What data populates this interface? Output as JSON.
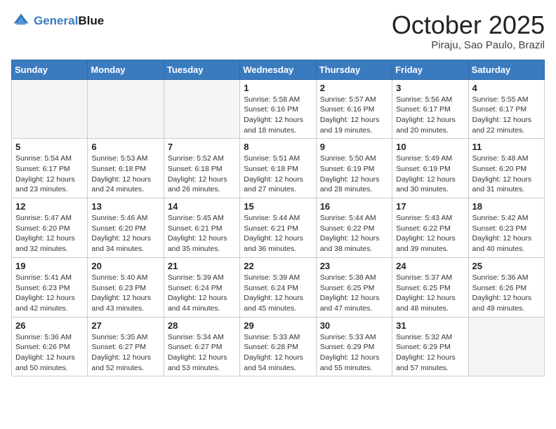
{
  "header": {
    "logo_line1": "General",
    "logo_line2": "Blue",
    "month": "October 2025",
    "location": "Piraju, Sao Paulo, Brazil"
  },
  "days_of_week": [
    "Sunday",
    "Monday",
    "Tuesday",
    "Wednesday",
    "Thursday",
    "Friday",
    "Saturday"
  ],
  "weeks": [
    [
      {
        "day": "",
        "info": ""
      },
      {
        "day": "",
        "info": ""
      },
      {
        "day": "",
        "info": ""
      },
      {
        "day": "1",
        "info": "Sunrise: 5:58 AM\nSunset: 6:16 PM\nDaylight: 12 hours\nand 18 minutes."
      },
      {
        "day": "2",
        "info": "Sunrise: 5:57 AM\nSunset: 6:16 PM\nDaylight: 12 hours\nand 19 minutes."
      },
      {
        "day": "3",
        "info": "Sunrise: 5:56 AM\nSunset: 6:17 PM\nDaylight: 12 hours\nand 20 minutes."
      },
      {
        "day": "4",
        "info": "Sunrise: 5:55 AM\nSunset: 6:17 PM\nDaylight: 12 hours\nand 22 minutes."
      }
    ],
    [
      {
        "day": "5",
        "info": "Sunrise: 5:54 AM\nSunset: 6:17 PM\nDaylight: 12 hours\nand 23 minutes."
      },
      {
        "day": "6",
        "info": "Sunrise: 5:53 AM\nSunset: 6:18 PM\nDaylight: 12 hours\nand 24 minutes."
      },
      {
        "day": "7",
        "info": "Sunrise: 5:52 AM\nSunset: 6:18 PM\nDaylight: 12 hours\nand 26 minutes."
      },
      {
        "day": "8",
        "info": "Sunrise: 5:51 AM\nSunset: 6:18 PM\nDaylight: 12 hours\nand 27 minutes."
      },
      {
        "day": "9",
        "info": "Sunrise: 5:50 AM\nSunset: 6:19 PM\nDaylight: 12 hours\nand 28 minutes."
      },
      {
        "day": "10",
        "info": "Sunrise: 5:49 AM\nSunset: 6:19 PM\nDaylight: 12 hours\nand 30 minutes."
      },
      {
        "day": "11",
        "info": "Sunrise: 5:48 AM\nSunset: 6:20 PM\nDaylight: 12 hours\nand 31 minutes."
      }
    ],
    [
      {
        "day": "12",
        "info": "Sunrise: 5:47 AM\nSunset: 6:20 PM\nDaylight: 12 hours\nand 32 minutes."
      },
      {
        "day": "13",
        "info": "Sunrise: 5:46 AM\nSunset: 6:20 PM\nDaylight: 12 hours\nand 34 minutes."
      },
      {
        "day": "14",
        "info": "Sunrise: 5:45 AM\nSunset: 6:21 PM\nDaylight: 12 hours\nand 35 minutes."
      },
      {
        "day": "15",
        "info": "Sunrise: 5:44 AM\nSunset: 6:21 PM\nDaylight: 12 hours\nand 36 minutes."
      },
      {
        "day": "16",
        "info": "Sunrise: 5:44 AM\nSunset: 6:22 PM\nDaylight: 12 hours\nand 38 minutes."
      },
      {
        "day": "17",
        "info": "Sunrise: 5:43 AM\nSunset: 6:22 PM\nDaylight: 12 hours\nand 39 minutes."
      },
      {
        "day": "18",
        "info": "Sunrise: 5:42 AM\nSunset: 6:23 PM\nDaylight: 12 hours\nand 40 minutes."
      }
    ],
    [
      {
        "day": "19",
        "info": "Sunrise: 5:41 AM\nSunset: 6:23 PM\nDaylight: 12 hours\nand 42 minutes."
      },
      {
        "day": "20",
        "info": "Sunrise: 5:40 AM\nSunset: 6:23 PM\nDaylight: 12 hours\nand 43 minutes."
      },
      {
        "day": "21",
        "info": "Sunrise: 5:39 AM\nSunset: 6:24 PM\nDaylight: 12 hours\nand 44 minutes."
      },
      {
        "day": "22",
        "info": "Sunrise: 5:39 AM\nSunset: 6:24 PM\nDaylight: 12 hours\nand 45 minutes."
      },
      {
        "day": "23",
        "info": "Sunrise: 5:38 AM\nSunset: 6:25 PM\nDaylight: 12 hours\nand 47 minutes."
      },
      {
        "day": "24",
        "info": "Sunrise: 5:37 AM\nSunset: 6:25 PM\nDaylight: 12 hours\nand 48 minutes."
      },
      {
        "day": "25",
        "info": "Sunrise: 5:36 AM\nSunset: 6:26 PM\nDaylight: 12 hours\nand 49 minutes."
      }
    ],
    [
      {
        "day": "26",
        "info": "Sunrise: 5:36 AM\nSunset: 6:26 PM\nDaylight: 12 hours\nand 50 minutes."
      },
      {
        "day": "27",
        "info": "Sunrise: 5:35 AM\nSunset: 6:27 PM\nDaylight: 12 hours\nand 52 minutes."
      },
      {
        "day": "28",
        "info": "Sunrise: 5:34 AM\nSunset: 6:27 PM\nDaylight: 12 hours\nand 53 minutes."
      },
      {
        "day": "29",
        "info": "Sunrise: 5:33 AM\nSunset: 6:28 PM\nDaylight: 12 hours\nand 54 minutes."
      },
      {
        "day": "30",
        "info": "Sunrise: 5:33 AM\nSunset: 6:29 PM\nDaylight: 12 hours\nand 55 minutes."
      },
      {
        "day": "31",
        "info": "Sunrise: 5:32 AM\nSunset: 6:29 PM\nDaylight: 12 hours\nand 57 minutes."
      },
      {
        "day": "",
        "info": ""
      }
    ]
  ]
}
